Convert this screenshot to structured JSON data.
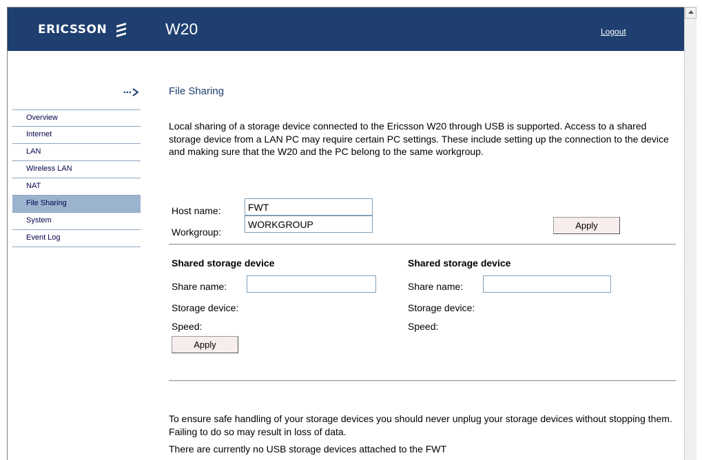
{
  "header": {
    "brand": "ERICSSON",
    "product": "W20",
    "logout_label": "Logout"
  },
  "nav": {
    "items": [
      {
        "label": "Overview",
        "active": false
      },
      {
        "label": "Internet",
        "active": false
      },
      {
        "label": "LAN",
        "active": false
      },
      {
        "label": "Wireless LAN",
        "active": false
      },
      {
        "label": "NAT",
        "active": false
      },
      {
        "label": "File Sharing",
        "active": true
      },
      {
        "label": "System",
        "active": false
      },
      {
        "label": "Event Log",
        "active": false
      }
    ]
  },
  "main": {
    "title": "File Sharing",
    "intro": "Local sharing of a storage device connected to the Ericsson W20 through USB is supported. Access to a shared storage device from a LAN PC may require certain PC settings. These include setting up the connection to the device and making sure that the W20 and the PC belong to the same workgroup.",
    "host_name_label": "Host name:",
    "host_name_value": "FWT",
    "workgroup_label": "Workgroup:",
    "workgroup_value": "WORKGROUP",
    "apply_label": "Apply",
    "shares": [
      {
        "title": "Shared storage device",
        "share_name_label": "Share name:",
        "share_name_value": "",
        "storage_device_label": "Storage device:",
        "speed_label": "Speed:"
      },
      {
        "title": "Shared storage device",
        "share_name_label": "Share name:",
        "share_name_value": "",
        "storage_device_label": "Storage device:",
        "speed_label": "Speed:"
      }
    ],
    "share_apply_label": "Apply",
    "safety_note": "To ensure safe handling of your storage devices you should never unplug your storage devices without stopping them. Failing to do so may result in loss of data.",
    "status_note": "There are currently no USB storage devices attached to the FWT"
  },
  "colors": {
    "header_bg": "#1e3f70",
    "nav_active_bg": "#9cb3d0",
    "button_bg": "#f7eded"
  },
  "icons": {
    "logo": "ericsson-logo-icon",
    "arrow": "dotted-arrow-icon",
    "scroll_up": "scroll-up-arrow-icon"
  }
}
